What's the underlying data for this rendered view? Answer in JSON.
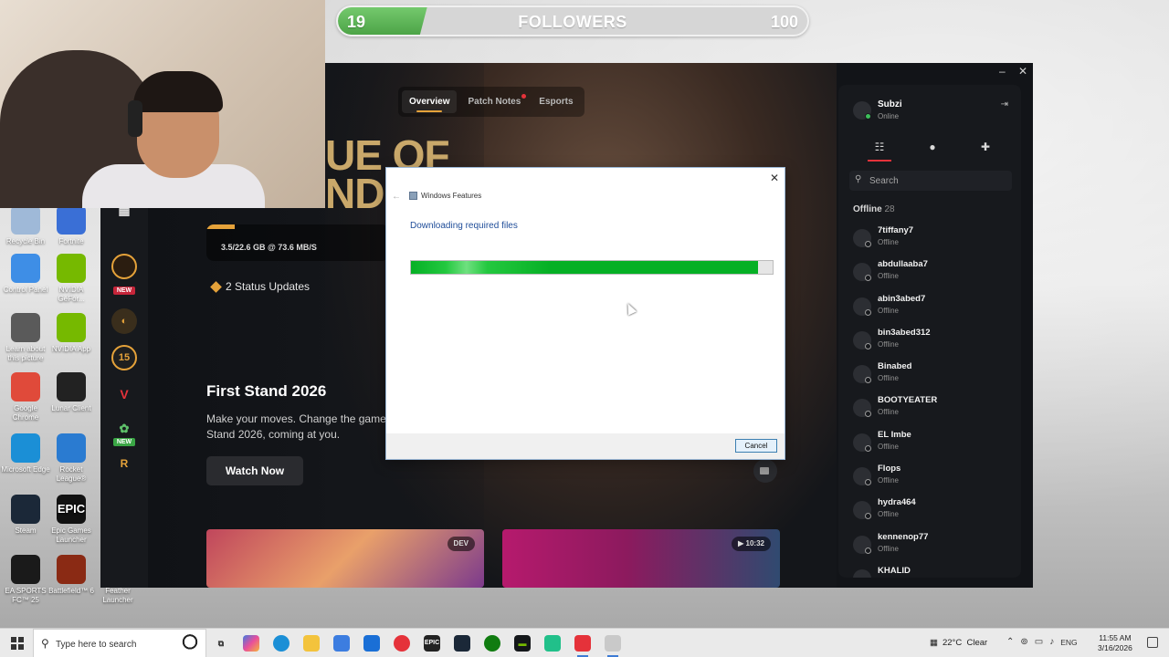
{
  "followers": {
    "count": "19",
    "label": "FOLLOWERS",
    "goal": "100",
    "progress": 0.19
  },
  "desktop_icons": [
    {
      "label": "Recycle Bin",
      "color": "#9fb9d8",
      "glyph": ""
    },
    {
      "label": "Fortnite",
      "color": "#3a6fd6",
      "glyph": ""
    },
    {
      "label": "Control Panel",
      "color": "#3e8ee6",
      "glyph": ""
    },
    {
      "label": "NVIDIA GeFor...",
      "color": "#76b900",
      "glyph": ""
    },
    {
      "label": "Learn about this picture",
      "color": "#5a5a5a",
      "glyph": ""
    },
    {
      "label": "NVIDIA App",
      "color": "#76b900",
      "glyph": ""
    },
    {
      "label": "Google Chrome",
      "color": "#e04a3a",
      "glyph": ""
    },
    {
      "label": "Lunar Client",
      "color": "#222222",
      "glyph": ""
    },
    {
      "label": "Microsoft Edge",
      "color": "#1b8fd6",
      "glyph": ""
    },
    {
      "label": "Rocket League®",
      "color": "#2a7bd1",
      "glyph": ""
    },
    {
      "label": "Steam",
      "color": "#1b2838",
      "glyph": ""
    },
    {
      "label": "Epic Games Launcher",
      "color": "#111111",
      "glyph": "EPIC"
    },
    {
      "label": "EA SPORTS FC™ 25",
      "color": "#1a1a1a",
      "glyph": ""
    },
    {
      "label": "Battlefield™ 6",
      "color": "#8a2a14",
      "glyph": ""
    },
    {
      "label": "Feather Launcher",
      "color": "",
      "glyph": ""
    }
  ],
  "client": {
    "logo_partial": "UE OF\nNDS",
    "tabs": [
      {
        "label": "Overview",
        "active": true,
        "dot": false
      },
      {
        "label": "Patch Notes",
        "active": false,
        "dot": true
      },
      {
        "label": "Esports",
        "active": false,
        "dot": false
      }
    ],
    "download": {
      "text": "3.5/22.6 GB @ 73.6 MB/S",
      "progress": 0.155
    },
    "status_updates": "2 Status Updates",
    "promo": {
      "title": "First Stand 2026",
      "body": "Make your moves. Change the game.\nStand 2026, coming at you.",
      "button": "Watch Now"
    },
    "rail": {
      "new_badge": "NEW",
      "badge_15": "15"
    },
    "cards": [
      {
        "badge": "DEV"
      },
      {
        "badge": "▶ 10:32"
      }
    ]
  },
  "friends": {
    "me": {
      "name": "Subzi",
      "status": "Online"
    },
    "search_placeholder": "Search",
    "offline_label": "Offline",
    "offline_count": "28",
    "list": [
      {
        "name": "7tiffany7",
        "status": "Offline"
      },
      {
        "name": "abdullaaba7",
        "status": "Offline"
      },
      {
        "name": "abin3abed7",
        "status": "Offline"
      },
      {
        "name": "bin3abed312",
        "status": "Offline"
      },
      {
        "name": "Binabed",
        "status": "Offline"
      },
      {
        "name": "BOOTYEATER",
        "status": "Offline"
      },
      {
        "name": "EL Imbe",
        "status": "Offline"
      },
      {
        "name": "Flops",
        "status": "Offline"
      },
      {
        "name": "hydra464",
        "status": "Offline"
      },
      {
        "name": "kennenop77",
        "status": "Offline"
      },
      {
        "name": "KHALID",
        "status": ""
      }
    ]
  },
  "dialog": {
    "title": "Windows Features",
    "heading": "Downloading required files",
    "progress": 0.96,
    "cancel": "Cancel"
  },
  "taskbar": {
    "search_placeholder": "Type here to search",
    "weather": "22°C  Clear",
    "language": "ENG",
    "time": "11:55 AM",
    "date": "3/16/2026"
  }
}
